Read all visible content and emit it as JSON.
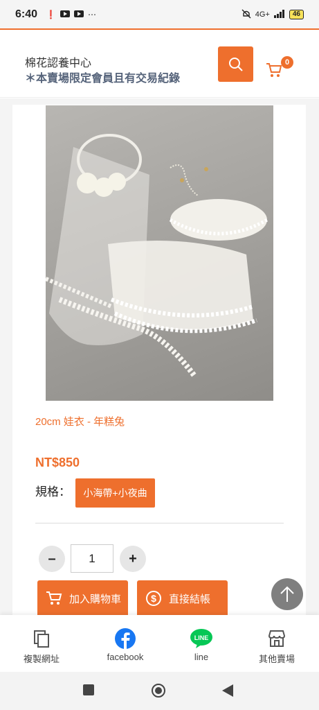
{
  "status_bar": {
    "time": "6:40",
    "left_icons": [
      "notification-icon",
      "youtube-icon",
      "youtube-icon",
      "more-icon"
    ],
    "network": "4G+",
    "battery": "46"
  },
  "header": {
    "shop_name": "棉花認養中心",
    "shop_note": "＊本賣場限定會員且有交易紀錄",
    "cart_count": "0"
  },
  "product": {
    "title": "20cm 娃衣 - 年糕兔",
    "price": "NT$850",
    "spec_label": "規格：",
    "spec_option": "小海帶+小夜曲",
    "quantity": "1",
    "add_to_cart_label": "加入購物車",
    "checkout_label": "直接結帳"
  },
  "bottom_nav": {
    "items": [
      {
        "label": "複製網址",
        "icon": "copy-icon"
      },
      {
        "label": "facebook",
        "icon": "facebook-icon"
      },
      {
        "label": "line",
        "icon": "line-icon"
      },
      {
        "label": "其他賣場",
        "icon": "store-icon"
      }
    ]
  },
  "colors": {
    "accent": "#ee6f2d",
    "note": "#55637a",
    "facebook": "#1877f2",
    "line": "#06c755"
  }
}
